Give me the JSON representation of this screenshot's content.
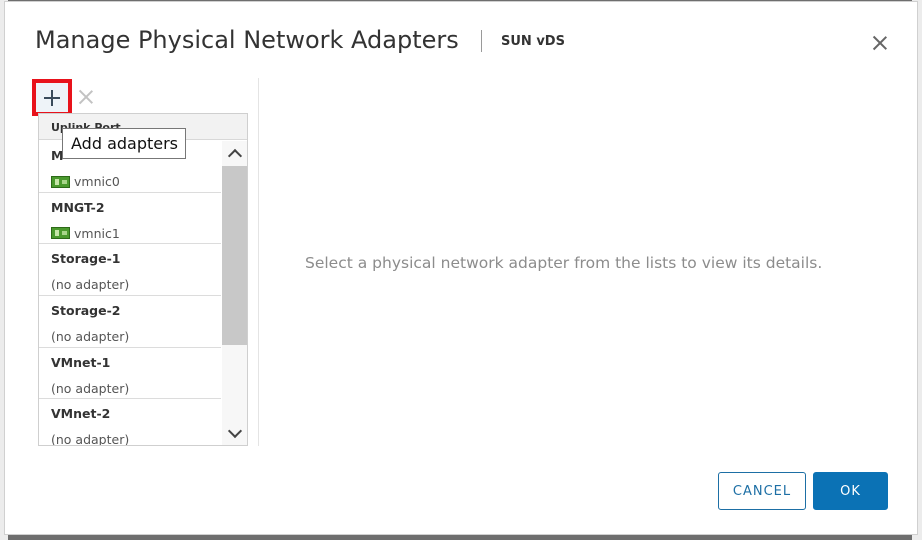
{
  "dialog": {
    "title": "Manage Physical Network Adapters",
    "subtitle": "SUN vDS",
    "close_icon": "close-icon"
  },
  "toolbar": {
    "add_icon": "plus-icon",
    "remove_icon": "x-icon",
    "add_highlight_color": "#e8121b"
  },
  "tooltip": {
    "text": "Add adapters"
  },
  "list": {
    "header": "Uplink Port",
    "items": [
      {
        "name": "M",
        "adapter": "vmnic0",
        "has_adapter": true
      },
      {
        "name": "MNGT-2",
        "adapter": "vmnic1",
        "has_adapter": true
      },
      {
        "name": "Storage-1",
        "adapter": "(no adapter)",
        "has_adapter": false
      },
      {
        "name": "Storage-2",
        "adapter": "(no adapter)",
        "has_adapter": false
      },
      {
        "name": "VMnet-1",
        "adapter": "(no adapter)",
        "has_adapter": false
      },
      {
        "name": "VMnet-2",
        "adapter": "(no adapter)",
        "has_adapter": false
      }
    ]
  },
  "details": {
    "empty_message": "Select a physical network adapter from the lists to view its details."
  },
  "footer": {
    "cancel_label": "CANCEL",
    "ok_label": "OK"
  },
  "colors": {
    "primary": "#0b72b5",
    "nic_icon": "#4b9a2e"
  }
}
